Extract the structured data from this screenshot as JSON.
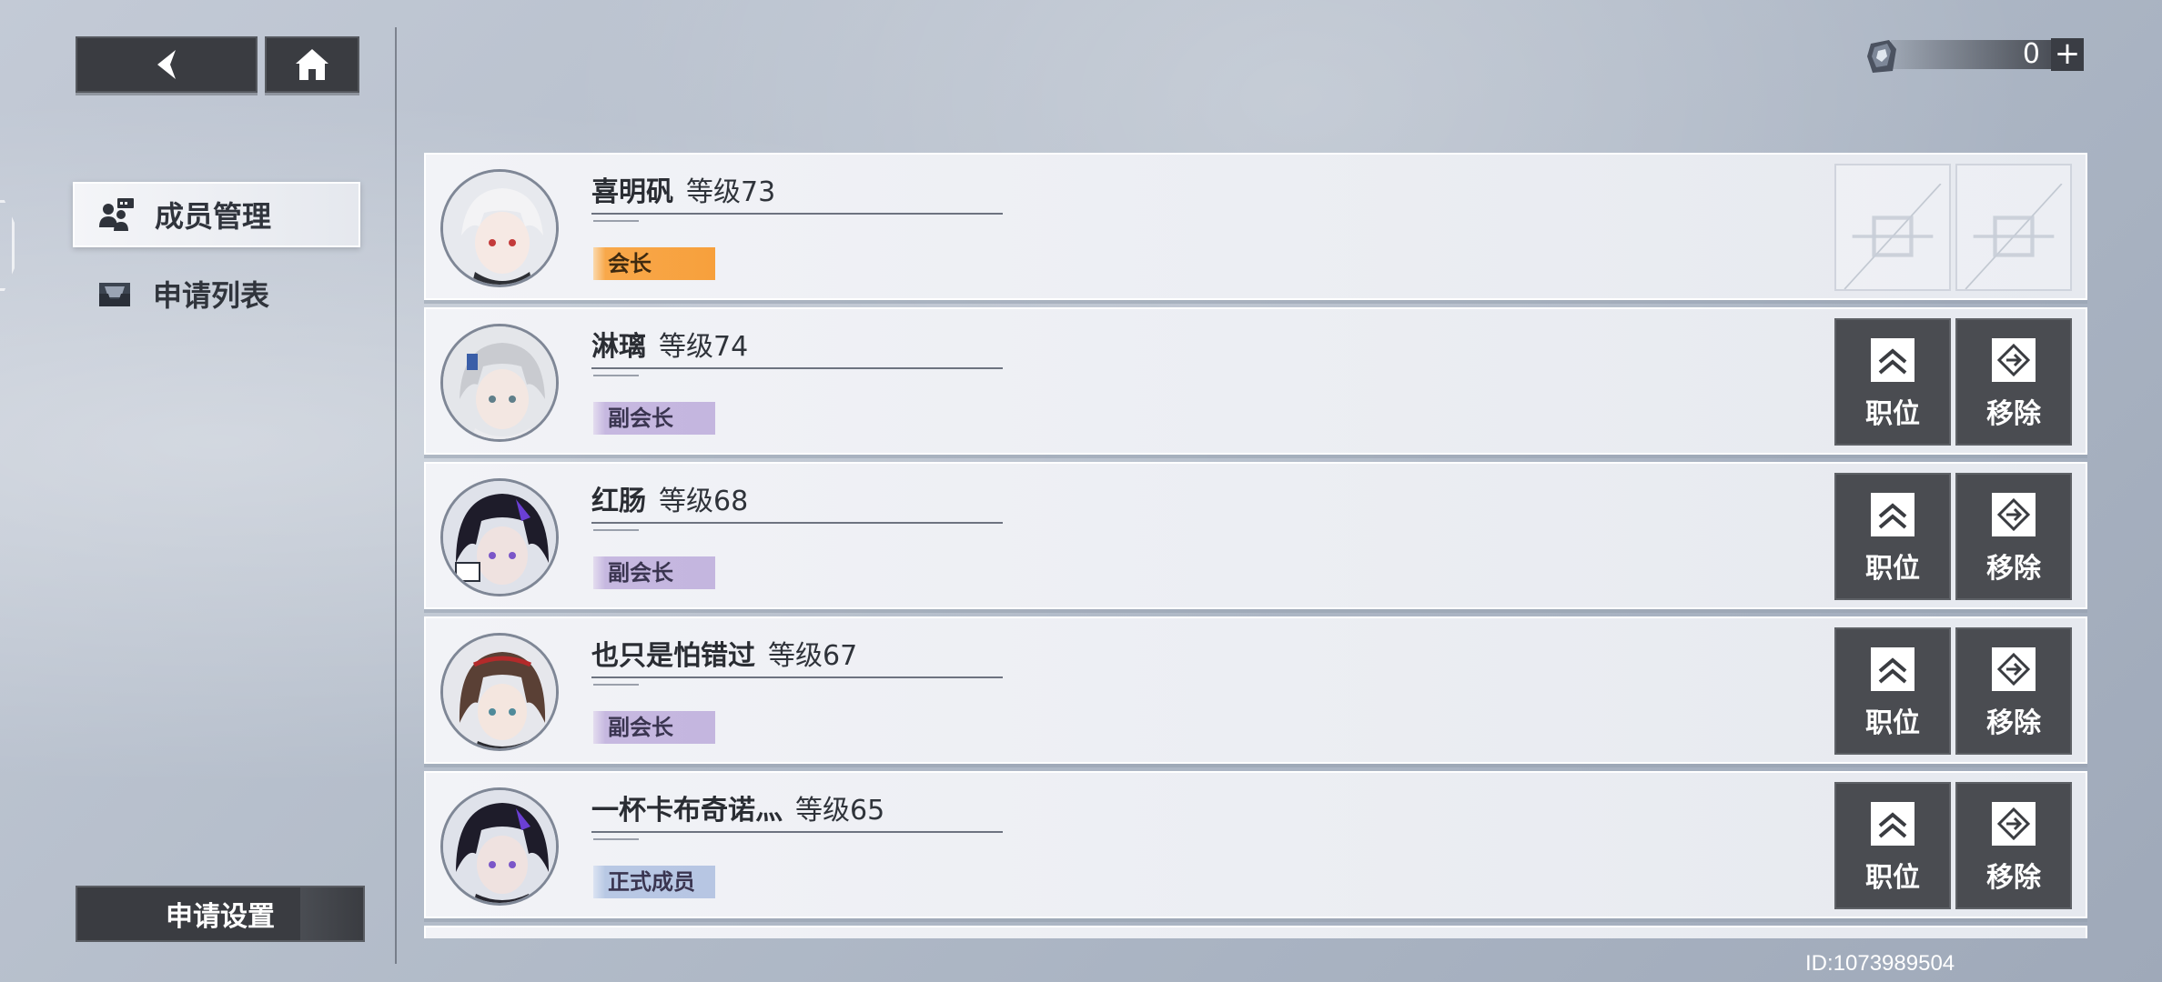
{
  "currency": {
    "amount": "0",
    "plus_label": "+"
  },
  "sidebar": {
    "items": [
      {
        "label": "成员管理",
        "icon": "members-icon",
        "active": true
      },
      {
        "label": "申请列表",
        "icon": "inbox-icon",
        "active": false
      }
    ],
    "apply_settings_label": "申请设置"
  },
  "members": [
    {
      "name": "喜明矾",
      "level": "等级73",
      "role": "会长",
      "role_type": "leader",
      "actions_enabled": false
    },
    {
      "name": "淋璃",
      "level": "等级74",
      "role": "副会长",
      "role_type": "vice",
      "actions_enabled": true
    },
    {
      "name": "红肠",
      "level": "等级68",
      "role": "副会长",
      "role_type": "vice",
      "actions_enabled": true
    },
    {
      "name": "也只是怕错过",
      "level": "等级67",
      "role": "副会长",
      "role_type": "vice",
      "actions_enabled": true
    },
    {
      "name": "一杯卡布奇诺灬",
      "level": "等级65",
      "role": "正式成员",
      "role_type": "member",
      "actions_enabled": true
    }
  ],
  "actions": {
    "position_label": "职位",
    "remove_label": "移除"
  },
  "footer": {
    "player_id": "ID:1073989504"
  },
  "colors": {
    "leader_badge": "#f7a03c",
    "vice_badge": "#c4b6df",
    "member_badge": "#b7c6e3",
    "button_dark": "#4a4c51"
  }
}
